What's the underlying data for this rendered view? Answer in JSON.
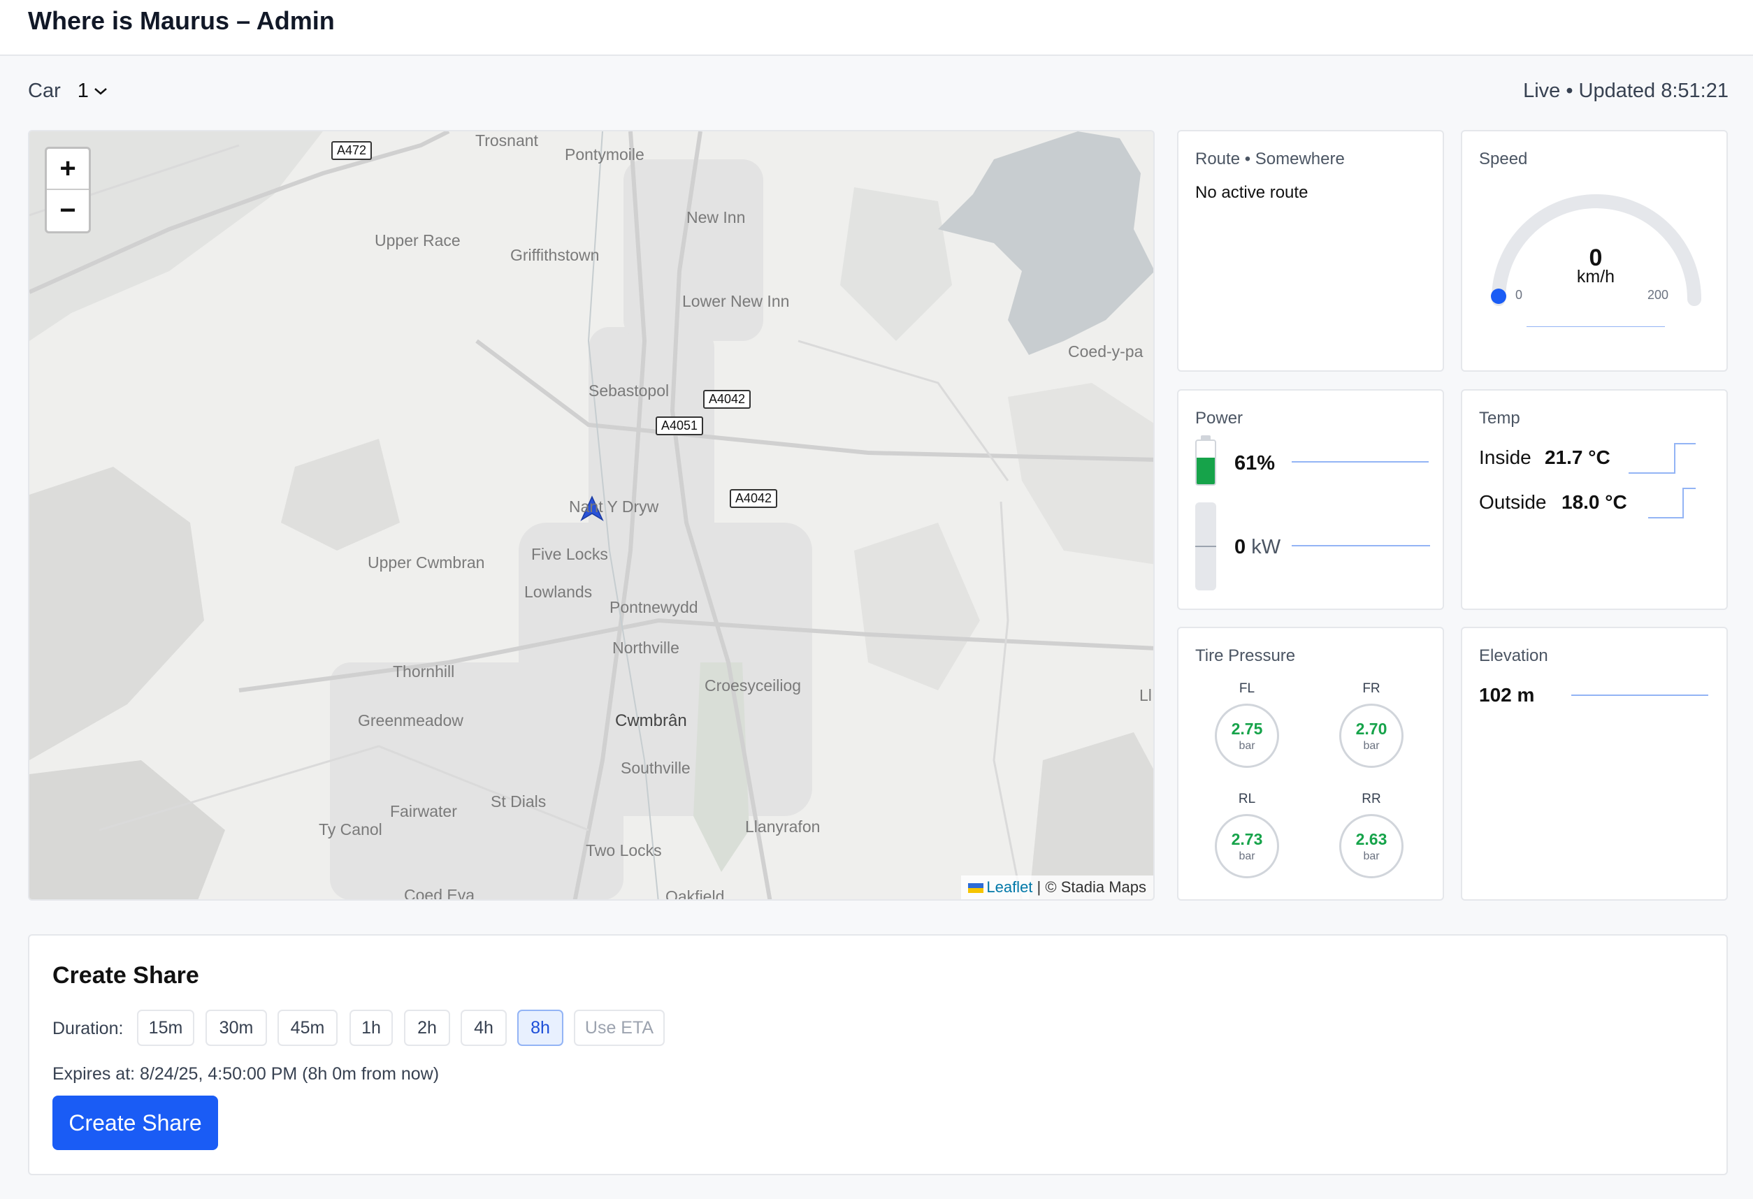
{
  "header": {
    "title": "Where is Maurus – Admin"
  },
  "car_selector": {
    "label": "Car",
    "value": "1"
  },
  "status": {
    "text": "Live • Updated 8:51:21"
  },
  "map": {
    "zoom_in": "+",
    "zoom_out": "−",
    "labels": [
      "Trosnant",
      "Pontymoile",
      "New Inn",
      "Upper Race",
      "Griffithstown",
      "Lower New Inn",
      "Coed-y-pa",
      "Sebastopol",
      "Nant Y Dryw",
      "Upper Cwmbran",
      "Five Locks",
      "Lowlands",
      "Pontnewydd",
      "Northville",
      "Thornhill",
      "Croesyceiliog",
      "Greenmeadow",
      "Cwmbrân",
      "Southville",
      "Fairwater",
      "St Dials",
      "Ty Canol",
      "Llanyrafon",
      "Two Locks",
      "Coed Eva",
      "Oakfield",
      "Ll"
    ],
    "roads": [
      "A472",
      "A4042",
      "A4051",
      "A4042"
    ],
    "attribution_link": "Leaflet",
    "attribution_text": "| © Stadia Maps"
  },
  "route": {
    "title": "Route • Somewhere",
    "status": "No active route"
  },
  "speed": {
    "title": "Speed",
    "value": "0",
    "unit": "km/h",
    "min": "0",
    "max": "200",
    "level": 0
  },
  "power": {
    "title": "Power",
    "battery_pct": "61%",
    "battery_level": 0.61,
    "kw_value": "0",
    "kw_unit": "kW"
  },
  "temp": {
    "title": "Temp",
    "inside_label": "Inside",
    "inside_value": "21.7 °C",
    "outside_label": "Outside",
    "outside_value": "18.0 °C"
  },
  "tires": {
    "title": "Tire Pressure",
    "unit": "bar",
    "fl": {
      "label": "FL",
      "value": "2.75"
    },
    "fr": {
      "label": "FR",
      "value": "2.70"
    },
    "rl": {
      "label": "RL",
      "value": "2.73"
    },
    "rr": {
      "label": "RR",
      "value": "2.63"
    }
  },
  "elevation": {
    "title": "Elevation",
    "value": "102 m"
  },
  "share": {
    "title": "Create Share",
    "duration_label": "Duration:",
    "durations": [
      "15m",
      "30m",
      "45m",
      "1h",
      "2h",
      "4h",
      "8h",
      "Use ETA"
    ],
    "selected": "8h",
    "expires": "Expires at: 8/24/25, 4:50:00 PM (8h 0m from now)",
    "button": "Create Share"
  },
  "colors": {
    "accent": "#1a5cf5",
    "battery": "#16a34a",
    "tire_ok": "#16a34a",
    "water": "#c8cdd0"
  }
}
